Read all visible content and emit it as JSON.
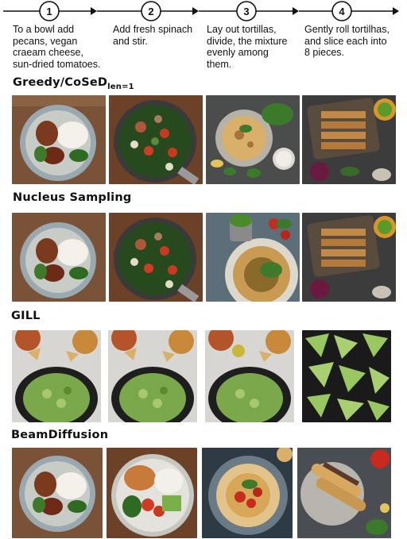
{
  "steps": [
    {
      "number": "1",
      "text": "To a bowl add\npecans, vegan\ncraeam cheese,\nsun-dried tomatoes."
    },
    {
      "number": "2",
      "text": "Add fresh spinach\nand stir."
    },
    {
      "number": "3",
      "text": "Lay out tortillas,\ndivide, the mixture\nevenly among\nthem."
    },
    {
      "number": "4",
      "text": "Gently roll tortilhas,\nand slice each into\n8 pieces."
    }
  ],
  "sections": [
    {
      "title": "Greedy/CoSeD",
      "subscript": "len=1",
      "images": [
        "bowl-pecans-cream-cheese",
        "skillet-spinach-tomatoes",
        "tortilla-with-dip",
        "sliced-quesadillas-tray"
      ]
    },
    {
      "title": "Nucleus Sampling",
      "subscript": "",
      "images": [
        "bowl-pecans-cream-cheese",
        "skillet-spinach-tomatoes",
        "tortilla-plate-basil",
        "sliced-quesadillas-tray"
      ]
    },
    {
      "title": "GILL",
      "subscript": "",
      "images": [
        "bowl-cucumber-salad",
        "bowl-cucumber-salad",
        "bowl-cucumber-salad",
        "tortilla-wedges-dark"
      ]
    },
    {
      "title": "BeamDiffusion",
      "subscript": "",
      "images": [
        "bowl-pecans-cream-cheese",
        "bowl-rice-vegetables",
        "tortilla-plate-tomatoes",
        "rolled-tortillas-tray"
      ]
    }
  ],
  "colors": {
    "line": "#111111",
    "text": "#111111"
  }
}
